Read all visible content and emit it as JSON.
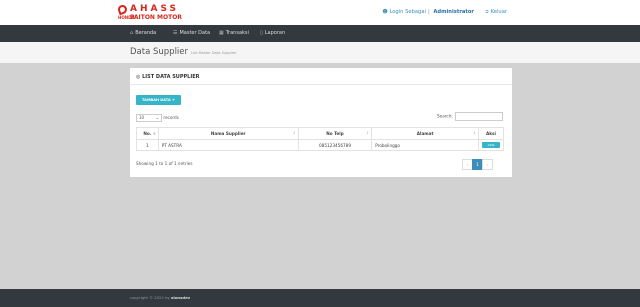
{
  "brand": {
    "line1": "AHASS",
    "honda": "HONDA",
    "line2": "PAITON MOTOR",
    "color": "#d9261c"
  },
  "user": {
    "icon": "user-icon",
    "label": "Login Sebagai",
    "name": "Administrator",
    "logout_icon": "logout-icon",
    "logout": "Keluar"
  },
  "nav": [
    {
      "icon": "home-icon",
      "label": "Beranda"
    },
    {
      "icon": "database-icon",
      "label": "Master Data"
    },
    {
      "icon": "cart-icon",
      "label": "Transaksi"
    },
    {
      "icon": "file-icon",
      "label": "Laporan"
    }
  ],
  "page": {
    "title": "Data Supplier",
    "subtitle": "List Master Data Supplier"
  },
  "card": {
    "title_icon": "list-icon",
    "title": "LIST DATA SUPPLIER",
    "add_button": "TAMBAH DATA +",
    "length_value": "10",
    "length_label": "records",
    "search_label": "Search:",
    "search_value": ""
  },
  "table": {
    "columns": [
      "No.",
      "Nama Supplier",
      "No Telp",
      "Alamat",
      "Aksi"
    ],
    "rows": [
      {
        "no": "1",
        "nama": "PT ASTRA",
        "telp": "085123456789",
        "alamat": "Probolinggo",
        "aksi": "AKSI"
      }
    ],
    "info": "Showing 1 to 1 of 1 entries",
    "pagination": {
      "prev": "‹",
      "current": "1",
      "next": "›"
    }
  },
  "footer": {
    "text": "copyright © 2022 by",
    "author": "alonsdev"
  },
  "colors": {
    "accent": "#36b5c8",
    "nav_bg": "#33393f",
    "link": "#3c8dbc"
  }
}
